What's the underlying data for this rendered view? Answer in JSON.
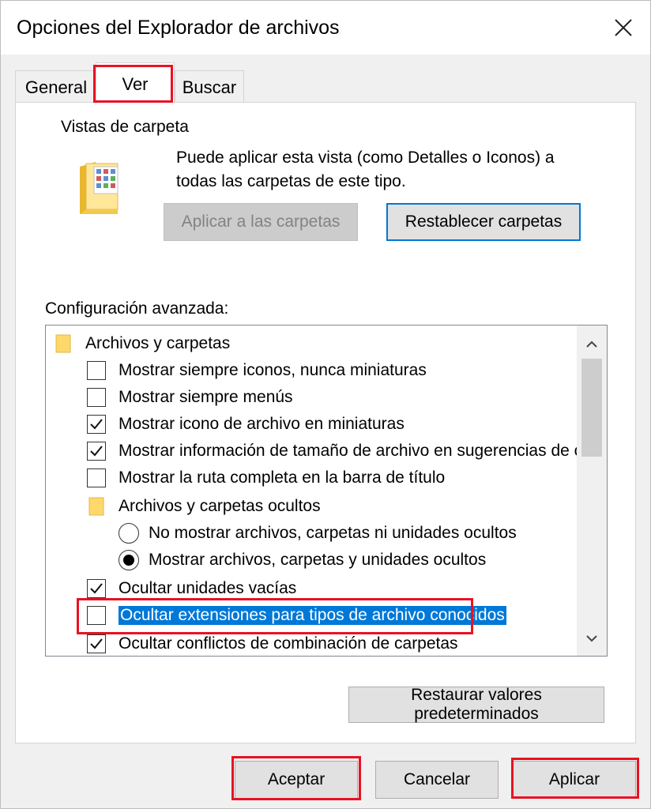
{
  "window": {
    "title": "Opciones del Explorador de archivos"
  },
  "tabs": [
    {
      "label": "General"
    },
    {
      "label": "Ver"
    },
    {
      "label": "Buscar"
    }
  ],
  "folder_views": {
    "legend": "Vistas de carpeta",
    "description": "Puede aplicar esta vista (como Detalles o Iconos) a todas las carpetas de este tipo.",
    "apply_button": "Aplicar a las carpetas",
    "reset_button": "Restablecer carpetas"
  },
  "advanced": {
    "label": "Configuración avanzada:",
    "items": [
      {
        "type": "folder",
        "label": "Archivos y carpetas"
      },
      {
        "type": "checkbox",
        "label": "Mostrar siempre iconos, nunca miniaturas",
        "checked": false
      },
      {
        "type": "checkbox",
        "label": "Mostrar siempre menús",
        "checked": false
      },
      {
        "type": "checkbox",
        "label": "Mostrar icono de archivo en miniaturas",
        "checked": true
      },
      {
        "type": "checkbox",
        "label": "Mostrar información de tamaño de archivo en sugerencias de carpeta",
        "checked": true
      },
      {
        "type": "checkbox",
        "label": "Mostrar la ruta completa en la barra de título",
        "checked": false
      },
      {
        "type": "folder",
        "label": "Archivos y carpetas ocultos"
      },
      {
        "type": "radio",
        "label": "No mostrar archivos, carpetas ni unidades ocultos",
        "checked": false
      },
      {
        "type": "radio",
        "label": "Mostrar archivos, carpetas y unidades ocultos",
        "checked": true
      },
      {
        "type": "checkbox",
        "label": "Ocultar unidades vacías",
        "checked": true
      },
      {
        "type": "checkbox",
        "label": "Ocultar extensiones para tipos de archivo conocidos",
        "checked": false,
        "selected": true
      },
      {
        "type": "checkbox",
        "label": "Ocultar conflictos de combinación de carpetas",
        "checked": true
      }
    ],
    "restore_button": "Restaurar valores predeterminados"
  },
  "buttons": {
    "accept": "Aceptar",
    "cancel": "Cancelar",
    "apply": "Aplicar"
  },
  "colors": {
    "highlight": "#e81224",
    "selection": "#0078d7"
  }
}
